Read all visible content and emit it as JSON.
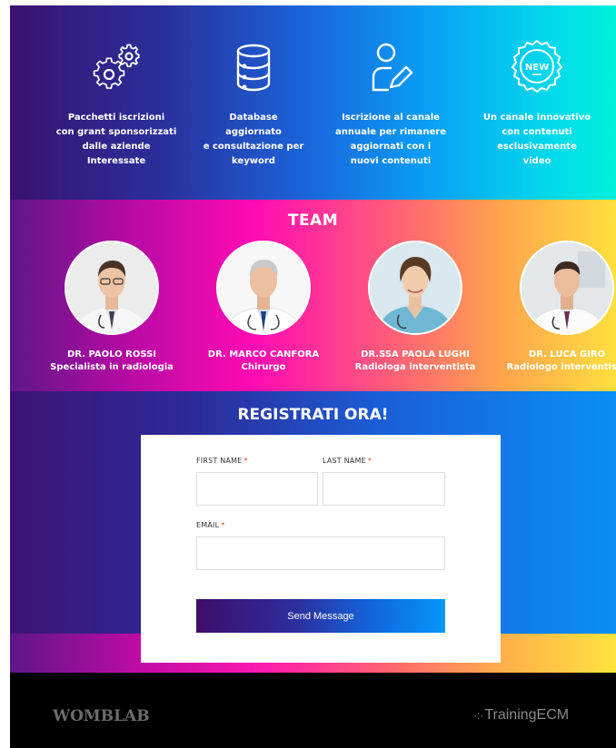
{
  "features": [
    {
      "icon": "gears-icon",
      "text": "Pacchetti iscrizioni\ncon grant sponsorizzati\ndalle aziende\nInteressate"
    },
    {
      "icon": "database-icon",
      "text": "Database\naggiornato\ne consultazione per\nkeyword"
    },
    {
      "icon": "user-edit-icon",
      "text": "Iscrizione al canale\nannuale per rimanere\naggiornati con i\nnuovi contenuti"
    },
    {
      "icon": "new-badge-icon",
      "badge_text": "NEW",
      "text": "Un canale innovativo\ncon contenuti\nesclusivamente\nvideo"
    }
  ],
  "team": {
    "title": "TEAM",
    "members": [
      {
        "name": "DR. PAOLO ROSSI",
        "role": "Specialista in radiologia"
      },
      {
        "name": "DR. MARCO CANFORA",
        "role": "Chirurgo"
      },
      {
        "name": "DR.SSA PAOLA LUGHI",
        "role": "Radiologa interventista"
      },
      {
        "name": "DR. LUCA GIRO",
        "role": "Radiologo interventista"
      }
    ]
  },
  "register": {
    "title": "REGISTRATI ORA!",
    "first_name_label": "FIRST NAME",
    "last_name_label": "LAST NAME",
    "email_label": "EMAIL",
    "required_mark": "*",
    "first_name_value": "",
    "last_name_value": "",
    "email_value": "",
    "submit_label": "Send Message"
  },
  "footer": {
    "left_logo": "WOMBLAB",
    "right_logo_prefix": "·:·",
    "right_logo": "TrainingECM"
  },
  "colors": {
    "required": "#e2401c",
    "footer_bg": "#000000"
  }
}
